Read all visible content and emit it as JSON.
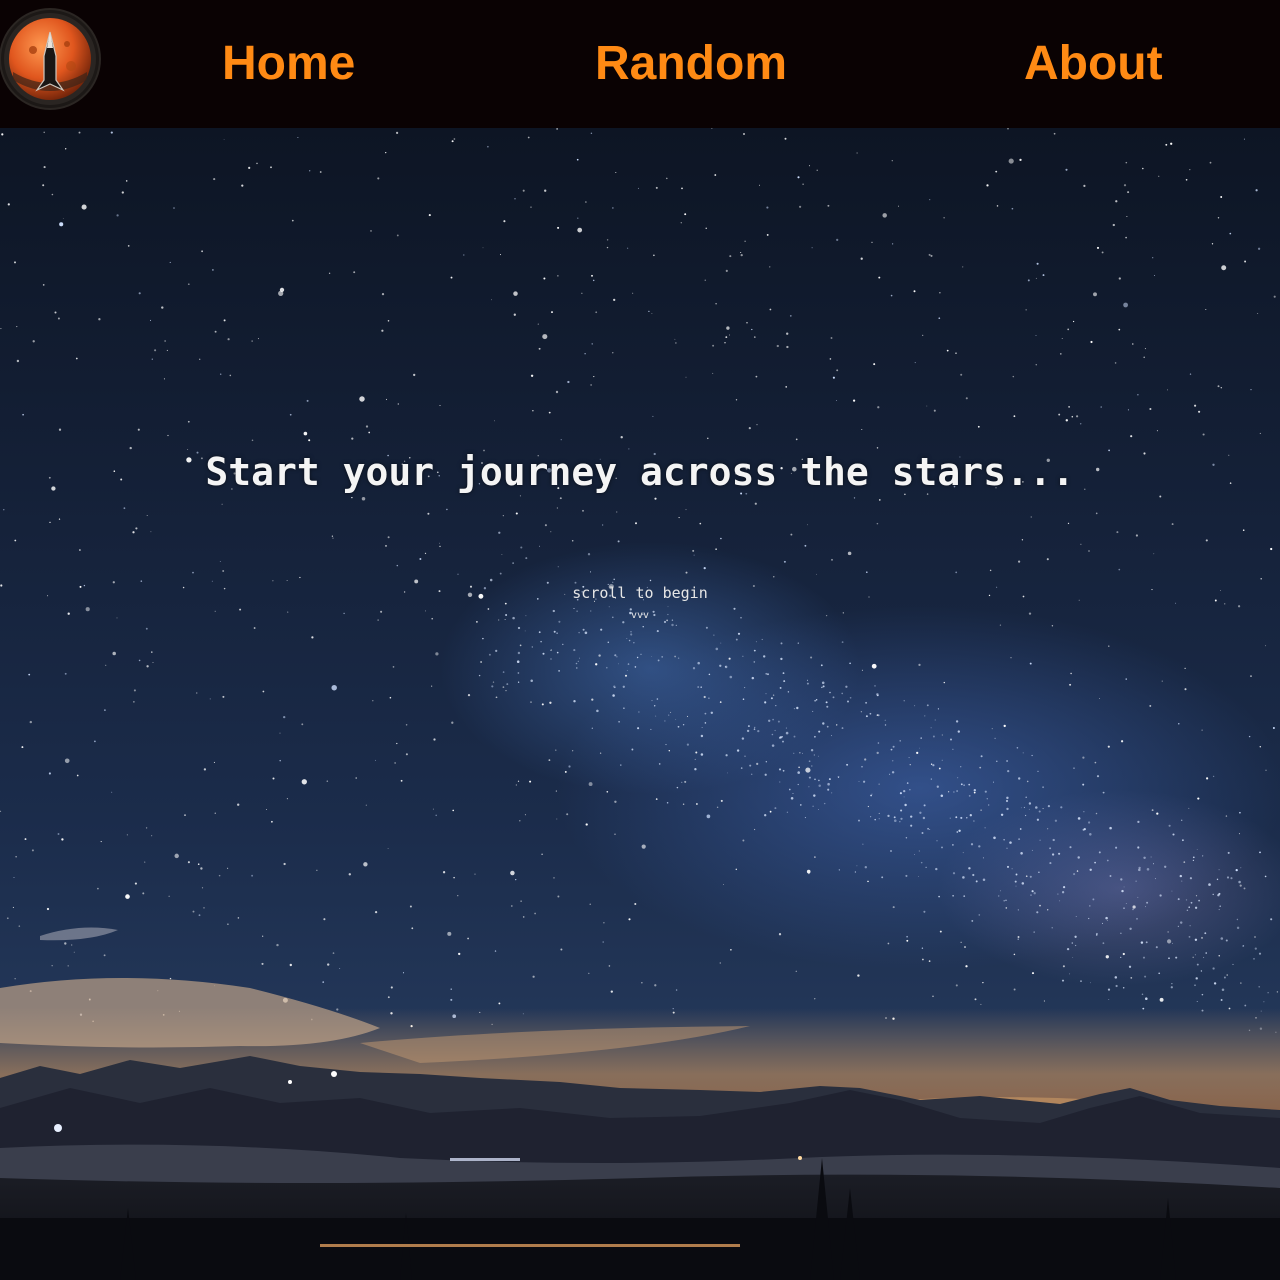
{
  "nav": {
    "logo_icon": "rocket-planet-logo-icon",
    "items": [
      {
        "label": "Home"
      },
      {
        "label": "Random"
      },
      {
        "label": "About"
      }
    ],
    "link_color": "#ff8a14",
    "background": "#0a0203"
  },
  "hero": {
    "title": "Start your journey across the stars...",
    "scroll_hint": "scroll to begin",
    "scroll_arrows": "vvv",
    "background_image": "night-sky-milky-way-mountains"
  }
}
